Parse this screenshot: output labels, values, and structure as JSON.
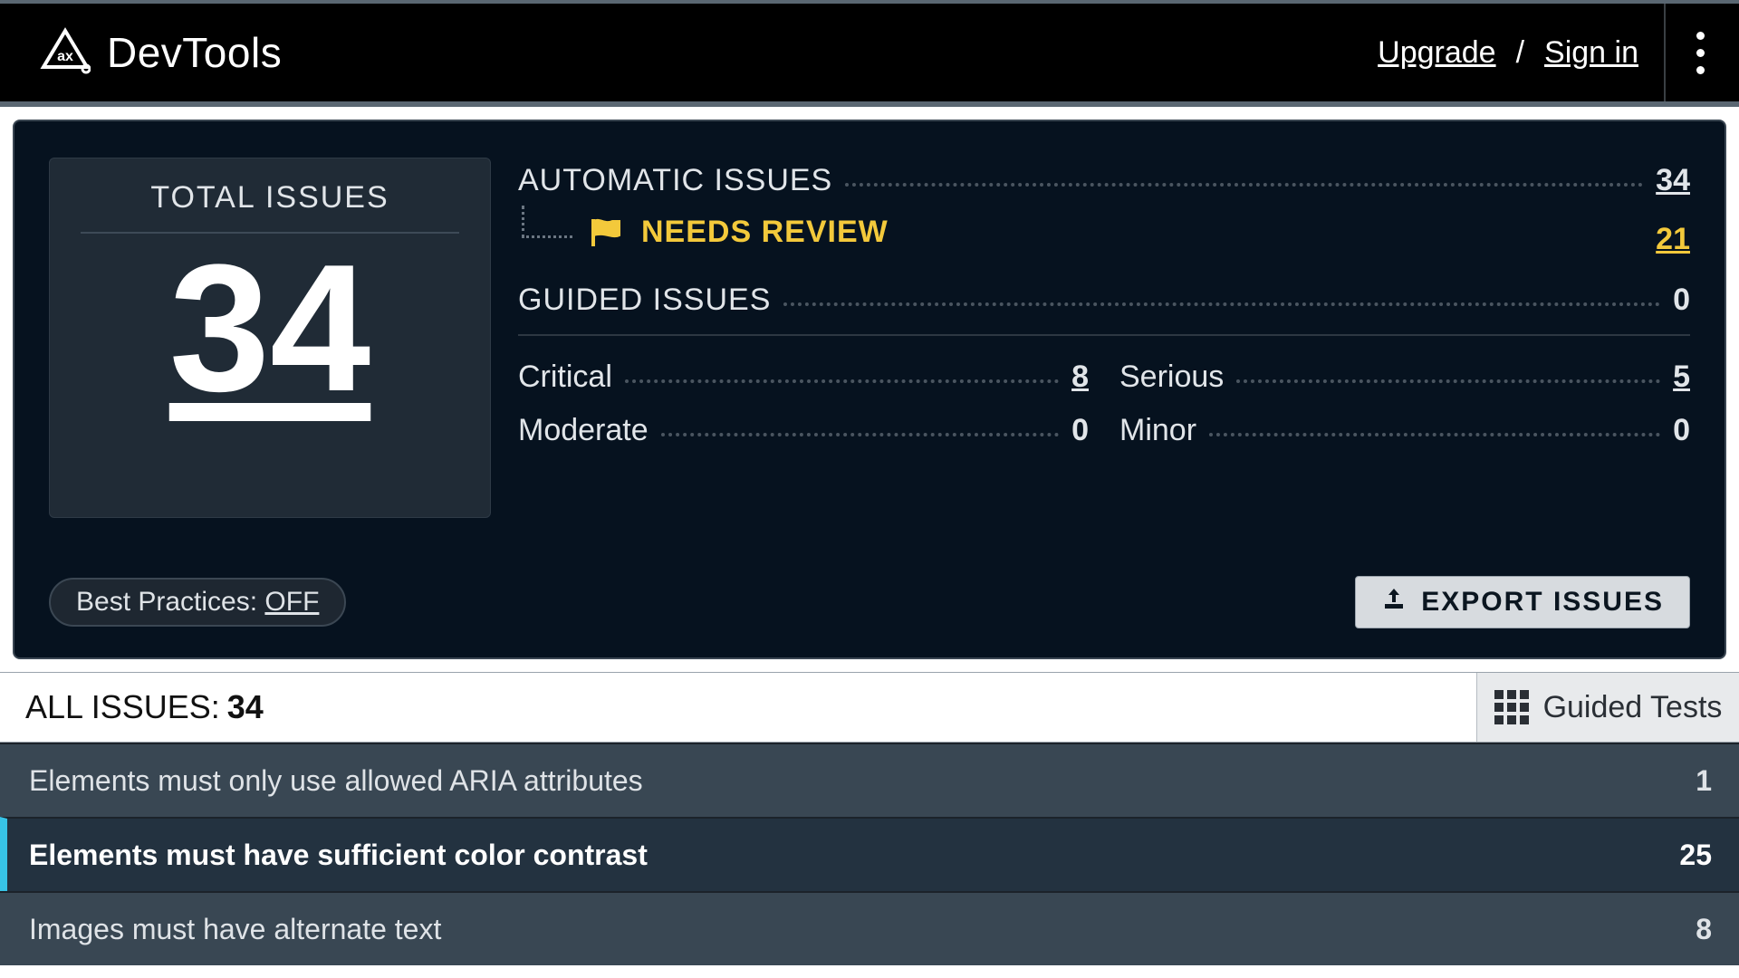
{
  "brand": {
    "title": "DevTools"
  },
  "top": {
    "upgrade": "Upgrade",
    "signin": "Sign in",
    "slash": "/"
  },
  "summary": {
    "total_label": "TOTAL ISSUES",
    "total": "34",
    "automatic_label": "AUTOMATIC ISSUES",
    "automatic": "34",
    "needs_review_label": "NEEDS REVIEW",
    "needs_review": "21",
    "guided_label": "GUIDED ISSUES",
    "guided": "0",
    "severity": {
      "critical_label": "Critical",
      "critical": "8",
      "serious_label": "Serious",
      "serious": "5",
      "moderate_label": "Moderate",
      "moderate": "0",
      "minor_label": "Minor",
      "minor": "0"
    }
  },
  "bp": {
    "label": "Best Practices: ",
    "state": "OFF"
  },
  "export_label": "EXPORT ISSUES",
  "tabs": {
    "all_label": "ALL ISSUES: ",
    "all_count": "34",
    "guided_label": "Guided Tests"
  },
  "issues": [
    {
      "title": "Elements must only use allowed ARIA attributes",
      "count": "1",
      "selected": false
    },
    {
      "title": "Elements must have sufficient color contrast",
      "count": "25",
      "selected": true
    },
    {
      "title": "Images must have alternate text",
      "count": "8",
      "selected": false
    }
  ]
}
